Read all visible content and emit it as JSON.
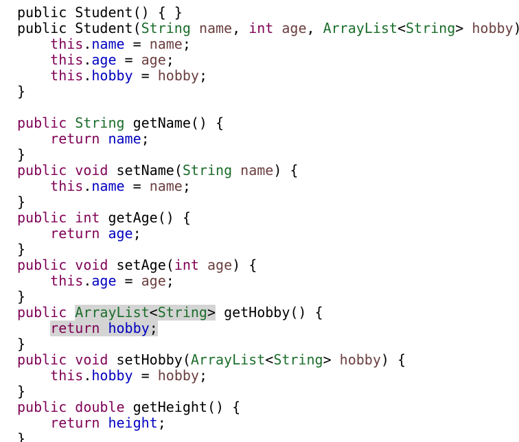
{
  "editor": {
    "lines": [
      [
        [
          "plain",
          "public"
        ],
        [
          "plain",
          " "
        ],
        [
          "method",
          "Student"
        ],
        [
          "plain",
          "() { }"
        ]
      ],
      [
        [
          "plain",
          "public"
        ],
        [
          "plain",
          " "
        ],
        [
          "method",
          "Student"
        ],
        [
          "plain",
          "("
        ],
        [
          "type",
          "String"
        ],
        [
          "plain",
          " "
        ],
        [
          "var",
          "name"
        ],
        [
          "plain",
          ", "
        ],
        [
          "kw",
          "int"
        ],
        [
          "plain",
          " "
        ],
        [
          "var",
          "age"
        ],
        [
          "plain",
          ", "
        ],
        [
          "type",
          "ArrayList"
        ],
        [
          "plain",
          "<"
        ],
        [
          "type",
          "String"
        ],
        [
          "plain",
          "> "
        ],
        [
          "var",
          "hobby"
        ],
        [
          "plain",
          ") {"
        ]
      ],
      [
        [
          "plain",
          "    "
        ],
        [
          "kw",
          "this"
        ],
        [
          "plain",
          "."
        ],
        [
          "field",
          "name"
        ],
        [
          "plain",
          " = "
        ],
        [
          "var",
          "name"
        ],
        [
          "plain",
          ";"
        ]
      ],
      [
        [
          "plain",
          "    "
        ],
        [
          "kw",
          "this"
        ],
        [
          "plain",
          "."
        ],
        [
          "field",
          "age"
        ],
        [
          "plain",
          " = "
        ],
        [
          "var",
          "age"
        ],
        [
          "plain",
          ";"
        ]
      ],
      [
        [
          "plain",
          "    "
        ],
        [
          "kw",
          "this"
        ],
        [
          "plain",
          "."
        ],
        [
          "field",
          "hobby"
        ],
        [
          "plain",
          " = "
        ],
        [
          "var",
          "hobby"
        ],
        [
          "plain",
          ";"
        ]
      ],
      [
        [
          "plain",
          "}"
        ]
      ],
      [
        [
          "plain",
          ""
        ]
      ],
      [
        [
          "kw",
          "public"
        ],
        [
          "plain",
          " "
        ],
        [
          "type",
          "String"
        ],
        [
          "plain",
          " "
        ],
        [
          "method",
          "getName"
        ],
        [
          "plain",
          "() {"
        ]
      ],
      [
        [
          "plain",
          "    "
        ],
        [
          "kw",
          "return"
        ],
        [
          "plain",
          " "
        ],
        [
          "field",
          "name"
        ],
        [
          "plain",
          ";"
        ]
      ],
      [
        [
          "plain",
          "}"
        ]
      ],
      [
        [
          "kw",
          "public"
        ],
        [
          "plain",
          " "
        ],
        [
          "kw",
          "void"
        ],
        [
          "plain",
          " "
        ],
        [
          "method",
          "setName"
        ],
        [
          "plain",
          "("
        ],
        [
          "type",
          "String"
        ],
        [
          "plain",
          " "
        ],
        [
          "var",
          "name"
        ],
        [
          "plain",
          ") {"
        ]
      ],
      [
        [
          "plain",
          "    "
        ],
        [
          "kw",
          "this"
        ],
        [
          "plain",
          "."
        ],
        [
          "field",
          "name"
        ],
        [
          "plain",
          " = "
        ],
        [
          "var",
          "name"
        ],
        [
          "plain",
          ";"
        ]
      ],
      [
        [
          "plain",
          "}"
        ]
      ],
      [
        [
          "kw",
          "public"
        ],
        [
          "plain",
          " "
        ],
        [
          "kw",
          "int"
        ],
        [
          "plain",
          " "
        ],
        [
          "method",
          "getAge"
        ],
        [
          "plain",
          "() {"
        ]
      ],
      [
        [
          "plain",
          "    "
        ],
        [
          "kw",
          "return"
        ],
        [
          "plain",
          " "
        ],
        [
          "field",
          "age"
        ],
        [
          "plain",
          ";"
        ]
      ],
      [
        [
          "plain",
          "}"
        ]
      ],
      [
        [
          "kw",
          "public"
        ],
        [
          "plain",
          " "
        ],
        [
          "kw",
          "void"
        ],
        [
          "plain",
          " "
        ],
        [
          "method",
          "setAge"
        ],
        [
          "plain",
          "("
        ],
        [
          "kw",
          "int"
        ],
        [
          "plain",
          " "
        ],
        [
          "var",
          "age"
        ],
        [
          "plain",
          ") {"
        ]
      ],
      [
        [
          "plain",
          "    "
        ],
        [
          "kw",
          "this"
        ],
        [
          "plain",
          "."
        ],
        [
          "field",
          "age"
        ],
        [
          "plain",
          " = "
        ],
        [
          "var",
          "age"
        ],
        [
          "plain",
          ";"
        ]
      ],
      [
        [
          "plain",
          "}"
        ]
      ],
      [
        [
          "kw",
          "public"
        ],
        [
          "plain",
          " "
        ],
        [
          "hl-type",
          "ArrayList<String>"
        ],
        [
          "plain",
          " "
        ],
        [
          "method",
          "getHobby"
        ],
        [
          "plain",
          "() {"
        ]
      ],
      [
        [
          "plain",
          "    "
        ],
        [
          "hl-stmt",
          "return hobby;"
        ]
      ],
      [
        [
          "plain",
          "}"
        ]
      ],
      [
        [
          "kw",
          "public"
        ],
        [
          "plain",
          " "
        ],
        [
          "kw",
          "void"
        ],
        [
          "plain",
          " "
        ],
        [
          "method",
          "setHobby"
        ],
        [
          "plain",
          "("
        ],
        [
          "type",
          "ArrayList"
        ],
        [
          "plain",
          "<"
        ],
        [
          "type",
          "String"
        ],
        [
          "plain",
          "> "
        ],
        [
          "var",
          "hobby"
        ],
        [
          "plain",
          ") {"
        ]
      ],
      [
        [
          "plain",
          "    "
        ],
        [
          "kw",
          "this"
        ],
        [
          "plain",
          "."
        ],
        [
          "field",
          "hobby"
        ],
        [
          "plain",
          " = "
        ],
        [
          "var",
          "hobby"
        ],
        [
          "plain",
          ";"
        ]
      ],
      [
        [
          "plain",
          "}"
        ]
      ],
      [
        [
          "kw",
          "public"
        ],
        [
          "plain",
          " "
        ],
        [
          "kw",
          "double"
        ],
        [
          "plain",
          " "
        ],
        [
          "method",
          "getHeight"
        ],
        [
          "plain",
          "() {"
        ]
      ],
      [
        [
          "plain",
          "    "
        ],
        [
          "kw",
          "return"
        ],
        [
          "plain",
          " "
        ],
        [
          "field",
          "height"
        ],
        [
          "plain",
          ";"
        ]
      ],
      [
        [
          "plain",
          "}"
        ]
      ]
    ]
  }
}
